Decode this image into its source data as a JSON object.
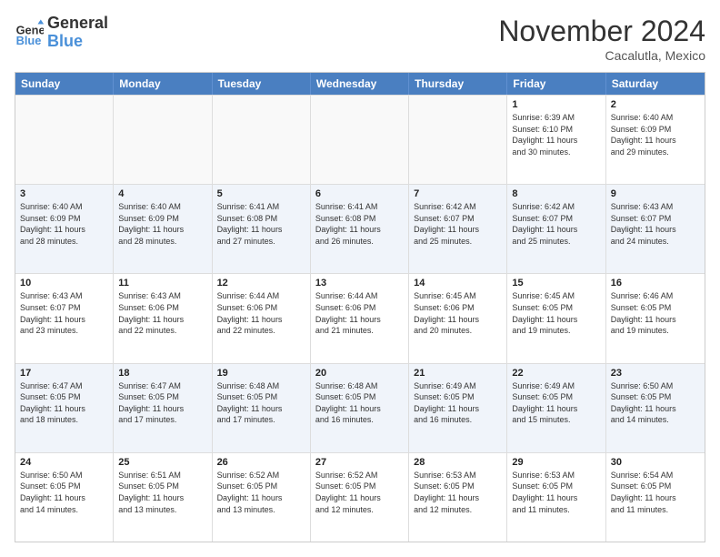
{
  "logo": {
    "general": "General",
    "blue": "Blue"
  },
  "title": "November 2024",
  "location": "Cacalutla, Mexico",
  "days": [
    "Sunday",
    "Monday",
    "Tuesday",
    "Wednesday",
    "Thursday",
    "Friday",
    "Saturday"
  ],
  "rows": [
    [
      {
        "day": "",
        "info": "",
        "empty": true
      },
      {
        "day": "",
        "info": "",
        "empty": true
      },
      {
        "day": "",
        "info": "",
        "empty": true
      },
      {
        "day": "",
        "info": "",
        "empty": true
      },
      {
        "day": "",
        "info": "",
        "empty": true
      },
      {
        "day": "1",
        "info": "Sunrise: 6:39 AM\nSunset: 6:10 PM\nDaylight: 11 hours\nand 30 minutes.",
        "empty": false,
        "alt": false
      },
      {
        "day": "2",
        "info": "Sunrise: 6:40 AM\nSunset: 6:09 PM\nDaylight: 11 hours\nand 29 minutes.",
        "empty": false,
        "alt": false
      }
    ],
    [
      {
        "day": "3",
        "info": "Sunrise: 6:40 AM\nSunset: 6:09 PM\nDaylight: 11 hours\nand 28 minutes.",
        "empty": false,
        "alt": true
      },
      {
        "day": "4",
        "info": "Sunrise: 6:40 AM\nSunset: 6:09 PM\nDaylight: 11 hours\nand 28 minutes.",
        "empty": false,
        "alt": true
      },
      {
        "day": "5",
        "info": "Sunrise: 6:41 AM\nSunset: 6:08 PM\nDaylight: 11 hours\nand 27 minutes.",
        "empty": false,
        "alt": true
      },
      {
        "day": "6",
        "info": "Sunrise: 6:41 AM\nSunset: 6:08 PM\nDaylight: 11 hours\nand 26 minutes.",
        "empty": false,
        "alt": true
      },
      {
        "day": "7",
        "info": "Sunrise: 6:42 AM\nSunset: 6:07 PM\nDaylight: 11 hours\nand 25 minutes.",
        "empty": false,
        "alt": true
      },
      {
        "day": "8",
        "info": "Sunrise: 6:42 AM\nSunset: 6:07 PM\nDaylight: 11 hours\nand 25 minutes.",
        "empty": false,
        "alt": true
      },
      {
        "day": "9",
        "info": "Sunrise: 6:43 AM\nSunset: 6:07 PM\nDaylight: 11 hours\nand 24 minutes.",
        "empty": false,
        "alt": true
      }
    ],
    [
      {
        "day": "10",
        "info": "Sunrise: 6:43 AM\nSunset: 6:07 PM\nDaylight: 11 hours\nand 23 minutes.",
        "empty": false,
        "alt": false
      },
      {
        "day": "11",
        "info": "Sunrise: 6:43 AM\nSunset: 6:06 PM\nDaylight: 11 hours\nand 22 minutes.",
        "empty": false,
        "alt": false
      },
      {
        "day": "12",
        "info": "Sunrise: 6:44 AM\nSunset: 6:06 PM\nDaylight: 11 hours\nand 22 minutes.",
        "empty": false,
        "alt": false
      },
      {
        "day": "13",
        "info": "Sunrise: 6:44 AM\nSunset: 6:06 PM\nDaylight: 11 hours\nand 21 minutes.",
        "empty": false,
        "alt": false
      },
      {
        "day": "14",
        "info": "Sunrise: 6:45 AM\nSunset: 6:06 PM\nDaylight: 11 hours\nand 20 minutes.",
        "empty": false,
        "alt": false
      },
      {
        "day": "15",
        "info": "Sunrise: 6:45 AM\nSunset: 6:05 PM\nDaylight: 11 hours\nand 19 minutes.",
        "empty": false,
        "alt": false
      },
      {
        "day": "16",
        "info": "Sunrise: 6:46 AM\nSunset: 6:05 PM\nDaylight: 11 hours\nand 19 minutes.",
        "empty": false,
        "alt": false
      }
    ],
    [
      {
        "day": "17",
        "info": "Sunrise: 6:47 AM\nSunset: 6:05 PM\nDaylight: 11 hours\nand 18 minutes.",
        "empty": false,
        "alt": true
      },
      {
        "day": "18",
        "info": "Sunrise: 6:47 AM\nSunset: 6:05 PM\nDaylight: 11 hours\nand 17 minutes.",
        "empty": false,
        "alt": true
      },
      {
        "day": "19",
        "info": "Sunrise: 6:48 AM\nSunset: 6:05 PM\nDaylight: 11 hours\nand 17 minutes.",
        "empty": false,
        "alt": true
      },
      {
        "day": "20",
        "info": "Sunrise: 6:48 AM\nSunset: 6:05 PM\nDaylight: 11 hours\nand 16 minutes.",
        "empty": false,
        "alt": true
      },
      {
        "day": "21",
        "info": "Sunrise: 6:49 AM\nSunset: 6:05 PM\nDaylight: 11 hours\nand 16 minutes.",
        "empty": false,
        "alt": true
      },
      {
        "day": "22",
        "info": "Sunrise: 6:49 AM\nSunset: 6:05 PM\nDaylight: 11 hours\nand 15 minutes.",
        "empty": false,
        "alt": true
      },
      {
        "day": "23",
        "info": "Sunrise: 6:50 AM\nSunset: 6:05 PM\nDaylight: 11 hours\nand 14 minutes.",
        "empty": false,
        "alt": true
      }
    ],
    [
      {
        "day": "24",
        "info": "Sunrise: 6:50 AM\nSunset: 6:05 PM\nDaylight: 11 hours\nand 14 minutes.",
        "empty": false,
        "alt": false
      },
      {
        "day": "25",
        "info": "Sunrise: 6:51 AM\nSunset: 6:05 PM\nDaylight: 11 hours\nand 13 minutes.",
        "empty": false,
        "alt": false
      },
      {
        "day": "26",
        "info": "Sunrise: 6:52 AM\nSunset: 6:05 PM\nDaylight: 11 hours\nand 13 minutes.",
        "empty": false,
        "alt": false
      },
      {
        "day": "27",
        "info": "Sunrise: 6:52 AM\nSunset: 6:05 PM\nDaylight: 11 hours\nand 12 minutes.",
        "empty": false,
        "alt": false
      },
      {
        "day": "28",
        "info": "Sunrise: 6:53 AM\nSunset: 6:05 PM\nDaylight: 11 hours\nand 12 minutes.",
        "empty": false,
        "alt": false
      },
      {
        "day": "29",
        "info": "Sunrise: 6:53 AM\nSunset: 6:05 PM\nDaylight: 11 hours\nand 11 minutes.",
        "empty": false,
        "alt": false
      },
      {
        "day": "30",
        "info": "Sunrise: 6:54 AM\nSunset: 6:05 PM\nDaylight: 11 hours\nand 11 minutes.",
        "empty": false,
        "alt": false
      }
    ]
  ]
}
